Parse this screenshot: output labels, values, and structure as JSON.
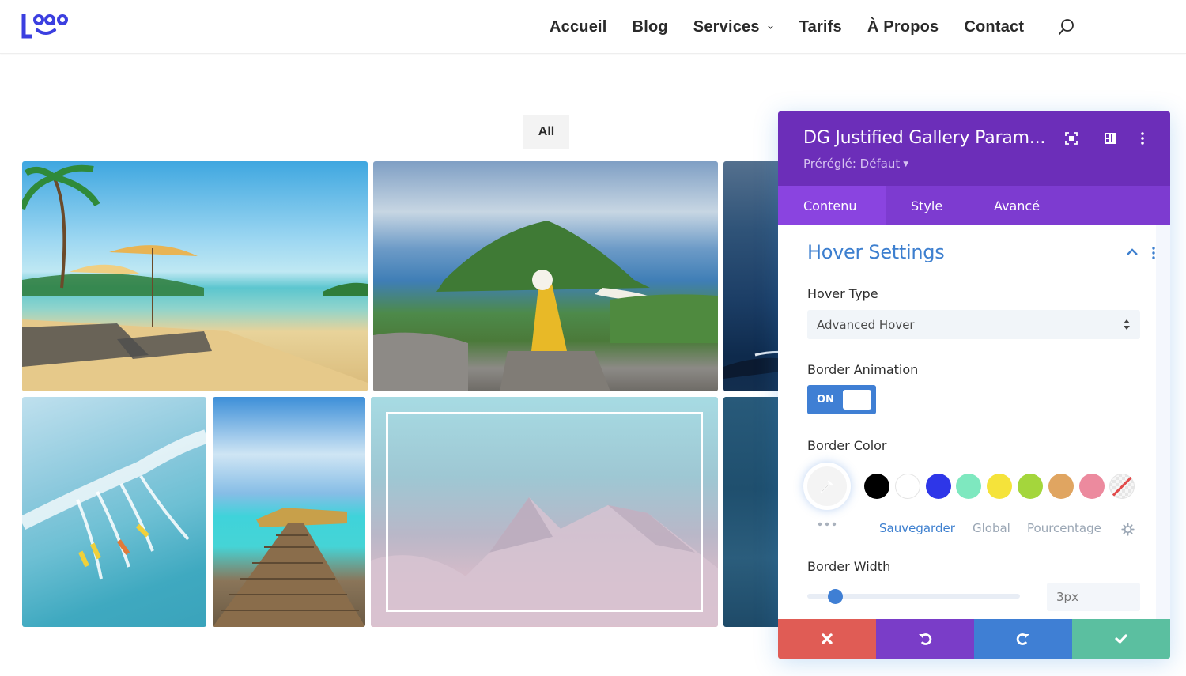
{
  "header": {
    "logo_text": "logo",
    "brand_color": "#3b3fe0",
    "nav": [
      {
        "label": "Accueil"
      },
      {
        "label": "Blog"
      },
      {
        "label": "Services",
        "has_dropdown": true
      },
      {
        "label": "Tarifs"
      },
      {
        "label": "À Propos"
      },
      {
        "label": "Contact"
      }
    ],
    "search_icon": "search-icon"
  },
  "gallery": {
    "filter_label": "All",
    "images": [
      {
        "subject": "tropical beach with umbrellas and loungers"
      },
      {
        "subject": "woman in yellow dress overlooking island"
      },
      {
        "subject": "dark ocean wave (partially hidden)"
      },
      {
        "subject": "surfers riding a wave from above"
      },
      {
        "subject": "wooden pier to overwater bungalows"
      },
      {
        "subject": "snowy mountains with pastel hover overlay",
        "hovered": true
      },
      {
        "subject": "deep blue water texture (partially hidden)"
      }
    ]
  },
  "panel": {
    "title": "DG Justified Gallery Param...",
    "preset": "Préréglé: Défaut",
    "header_icons": [
      "fullscreen-icon",
      "split-view-icon",
      "more-options-icon"
    ],
    "tabs": [
      {
        "label": "Contenu",
        "active": true
      },
      {
        "label": "Style",
        "active": false
      },
      {
        "label": "Avancé",
        "active": false
      }
    ],
    "section": {
      "title": "Hover Settings",
      "expanded": true
    },
    "hover_type": {
      "label": "Hover Type",
      "value": "Advanced Hover"
    },
    "border_animation": {
      "label": "Border Animation",
      "state": "ON"
    },
    "border_color": {
      "label": "Border Color",
      "swatches": [
        {
          "name": "black",
          "color": "#000000"
        },
        {
          "name": "white",
          "color": "#ffffff"
        },
        {
          "name": "blue",
          "color": "#2e36e8"
        },
        {
          "name": "mint",
          "color": "#7ee8bf"
        },
        {
          "name": "yellow",
          "color": "#f5e33a"
        },
        {
          "name": "lime",
          "color": "#a4d63c"
        },
        {
          "name": "tan",
          "color": "#e0a561"
        },
        {
          "name": "pink",
          "color": "#ec8a9e"
        },
        {
          "name": "none",
          "color": "transparent"
        }
      ],
      "tabs": [
        {
          "label": "Sauvegarder",
          "active": true
        },
        {
          "label": "Global",
          "active": false
        },
        {
          "label": "Pourcentage",
          "active": false
        }
      ]
    },
    "border_width": {
      "label": "Border Width",
      "value": "3px",
      "slider_fraction": 0.13
    },
    "footer": {
      "cancel_color": "#e05c55",
      "undo_color": "#7a3dc8",
      "redo_color": "#3f7fd4",
      "save_color": "#5bbfa0"
    },
    "colors": {
      "header_bg": "#6c2eb9",
      "tabs_bg": "#7d3bd0",
      "active_tab_bg": "#8a44e0",
      "accent_blue": "#3f7fd4"
    }
  }
}
